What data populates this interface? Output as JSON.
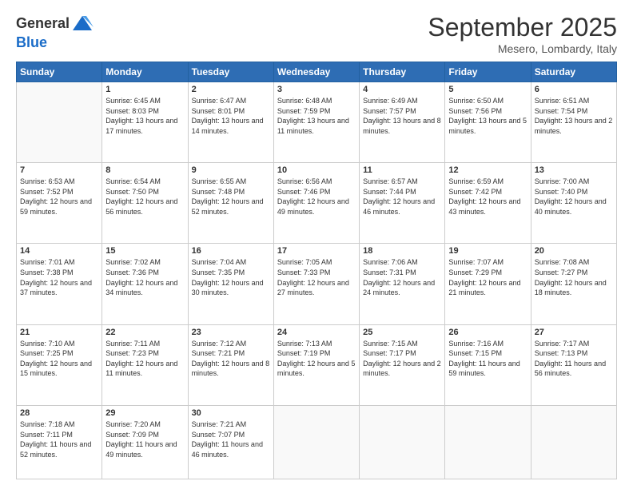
{
  "header": {
    "logo_line1": "General",
    "logo_line2": "Blue",
    "month_title": "September 2025",
    "location": "Mesero, Lombardy, Italy"
  },
  "days_of_week": [
    "Sunday",
    "Monday",
    "Tuesday",
    "Wednesday",
    "Thursday",
    "Friday",
    "Saturday"
  ],
  "weeks": [
    [
      {
        "day": "",
        "sunrise": "",
        "sunset": "",
        "daylight": ""
      },
      {
        "day": "1",
        "sunrise": "Sunrise: 6:45 AM",
        "sunset": "Sunset: 8:03 PM",
        "daylight": "Daylight: 13 hours and 17 minutes."
      },
      {
        "day": "2",
        "sunrise": "Sunrise: 6:47 AM",
        "sunset": "Sunset: 8:01 PM",
        "daylight": "Daylight: 13 hours and 14 minutes."
      },
      {
        "day": "3",
        "sunrise": "Sunrise: 6:48 AM",
        "sunset": "Sunset: 7:59 PM",
        "daylight": "Daylight: 13 hours and 11 minutes."
      },
      {
        "day": "4",
        "sunrise": "Sunrise: 6:49 AM",
        "sunset": "Sunset: 7:57 PM",
        "daylight": "Daylight: 13 hours and 8 minutes."
      },
      {
        "day": "5",
        "sunrise": "Sunrise: 6:50 AM",
        "sunset": "Sunset: 7:56 PM",
        "daylight": "Daylight: 13 hours and 5 minutes."
      },
      {
        "day": "6",
        "sunrise": "Sunrise: 6:51 AM",
        "sunset": "Sunset: 7:54 PM",
        "daylight": "Daylight: 13 hours and 2 minutes."
      }
    ],
    [
      {
        "day": "7",
        "sunrise": "Sunrise: 6:53 AM",
        "sunset": "Sunset: 7:52 PM",
        "daylight": "Daylight: 12 hours and 59 minutes."
      },
      {
        "day": "8",
        "sunrise": "Sunrise: 6:54 AM",
        "sunset": "Sunset: 7:50 PM",
        "daylight": "Daylight: 12 hours and 56 minutes."
      },
      {
        "day": "9",
        "sunrise": "Sunrise: 6:55 AM",
        "sunset": "Sunset: 7:48 PM",
        "daylight": "Daylight: 12 hours and 52 minutes."
      },
      {
        "day": "10",
        "sunrise": "Sunrise: 6:56 AM",
        "sunset": "Sunset: 7:46 PM",
        "daylight": "Daylight: 12 hours and 49 minutes."
      },
      {
        "day": "11",
        "sunrise": "Sunrise: 6:57 AM",
        "sunset": "Sunset: 7:44 PM",
        "daylight": "Daylight: 12 hours and 46 minutes."
      },
      {
        "day": "12",
        "sunrise": "Sunrise: 6:59 AM",
        "sunset": "Sunset: 7:42 PM",
        "daylight": "Daylight: 12 hours and 43 minutes."
      },
      {
        "day": "13",
        "sunrise": "Sunrise: 7:00 AM",
        "sunset": "Sunset: 7:40 PM",
        "daylight": "Daylight: 12 hours and 40 minutes."
      }
    ],
    [
      {
        "day": "14",
        "sunrise": "Sunrise: 7:01 AM",
        "sunset": "Sunset: 7:38 PM",
        "daylight": "Daylight: 12 hours and 37 minutes."
      },
      {
        "day": "15",
        "sunrise": "Sunrise: 7:02 AM",
        "sunset": "Sunset: 7:36 PM",
        "daylight": "Daylight: 12 hours and 34 minutes."
      },
      {
        "day": "16",
        "sunrise": "Sunrise: 7:04 AM",
        "sunset": "Sunset: 7:35 PM",
        "daylight": "Daylight: 12 hours and 30 minutes."
      },
      {
        "day": "17",
        "sunrise": "Sunrise: 7:05 AM",
        "sunset": "Sunset: 7:33 PM",
        "daylight": "Daylight: 12 hours and 27 minutes."
      },
      {
        "day": "18",
        "sunrise": "Sunrise: 7:06 AM",
        "sunset": "Sunset: 7:31 PM",
        "daylight": "Daylight: 12 hours and 24 minutes."
      },
      {
        "day": "19",
        "sunrise": "Sunrise: 7:07 AM",
        "sunset": "Sunset: 7:29 PM",
        "daylight": "Daylight: 12 hours and 21 minutes."
      },
      {
        "day": "20",
        "sunrise": "Sunrise: 7:08 AM",
        "sunset": "Sunset: 7:27 PM",
        "daylight": "Daylight: 12 hours and 18 minutes."
      }
    ],
    [
      {
        "day": "21",
        "sunrise": "Sunrise: 7:10 AM",
        "sunset": "Sunset: 7:25 PM",
        "daylight": "Daylight: 12 hours and 15 minutes."
      },
      {
        "day": "22",
        "sunrise": "Sunrise: 7:11 AM",
        "sunset": "Sunset: 7:23 PM",
        "daylight": "Daylight: 12 hours and 11 minutes."
      },
      {
        "day": "23",
        "sunrise": "Sunrise: 7:12 AM",
        "sunset": "Sunset: 7:21 PM",
        "daylight": "Daylight: 12 hours and 8 minutes."
      },
      {
        "day": "24",
        "sunrise": "Sunrise: 7:13 AM",
        "sunset": "Sunset: 7:19 PM",
        "daylight": "Daylight: 12 hours and 5 minutes."
      },
      {
        "day": "25",
        "sunrise": "Sunrise: 7:15 AM",
        "sunset": "Sunset: 7:17 PM",
        "daylight": "Daylight: 12 hours and 2 minutes."
      },
      {
        "day": "26",
        "sunrise": "Sunrise: 7:16 AM",
        "sunset": "Sunset: 7:15 PM",
        "daylight": "Daylight: 11 hours and 59 minutes."
      },
      {
        "day": "27",
        "sunrise": "Sunrise: 7:17 AM",
        "sunset": "Sunset: 7:13 PM",
        "daylight": "Daylight: 11 hours and 56 minutes."
      }
    ],
    [
      {
        "day": "28",
        "sunrise": "Sunrise: 7:18 AM",
        "sunset": "Sunset: 7:11 PM",
        "daylight": "Daylight: 11 hours and 52 minutes."
      },
      {
        "day": "29",
        "sunrise": "Sunrise: 7:20 AM",
        "sunset": "Sunset: 7:09 PM",
        "daylight": "Daylight: 11 hours and 49 minutes."
      },
      {
        "day": "30",
        "sunrise": "Sunrise: 7:21 AM",
        "sunset": "Sunset: 7:07 PM",
        "daylight": "Daylight: 11 hours and 46 minutes."
      },
      {
        "day": "",
        "sunrise": "",
        "sunset": "",
        "daylight": ""
      },
      {
        "day": "",
        "sunrise": "",
        "sunset": "",
        "daylight": ""
      },
      {
        "day": "",
        "sunrise": "",
        "sunset": "",
        "daylight": ""
      },
      {
        "day": "",
        "sunrise": "",
        "sunset": "",
        "daylight": ""
      }
    ]
  ]
}
